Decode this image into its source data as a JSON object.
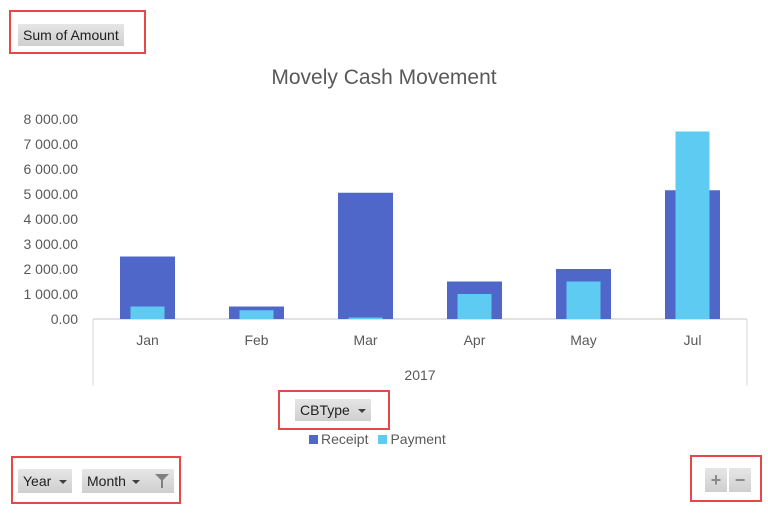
{
  "value_field_button": "Sum of Amount",
  "legend_field_button": "CBType",
  "axis_field_buttons": [
    {
      "label": "Year",
      "icon": "dropdown-arrow-icon"
    },
    {
      "label": "Month",
      "icon": "filter-icon"
    }
  ],
  "zoom_buttons": {
    "expand": "+",
    "collapse": "−"
  },
  "colors": {
    "receipt": "#4f67c9",
    "payment": "#5ecbf2",
    "highlight_box": "#e8474a"
  },
  "chart_data": {
    "type": "bar",
    "title": "Movely Cash Movement",
    "xlabel": "",
    "ylabel": "",
    "categories": [
      "Jan",
      "Feb",
      "Mar",
      "Apr",
      "May",
      "Jul"
    ],
    "category_group": "2017",
    "series": [
      {
        "name": "Receipt",
        "values": [
          2500,
          500,
          5050,
          1500,
          2000,
          5150
        ]
      },
      {
        "name": "Payment",
        "values": [
          500,
          350,
          60,
          1000,
          1500,
          7500
        ]
      }
    ],
    "ylim": [
      0,
      8000
    ],
    "yticks": [
      "0.00",
      "1 000.00",
      "2 000.00",
      "3 000.00",
      "4 000.00",
      "5 000.00",
      "6 000.00",
      "7 000.00",
      "8 000.00"
    ],
    "grid": false,
    "legend": "bottom",
    "overlap": true
  }
}
